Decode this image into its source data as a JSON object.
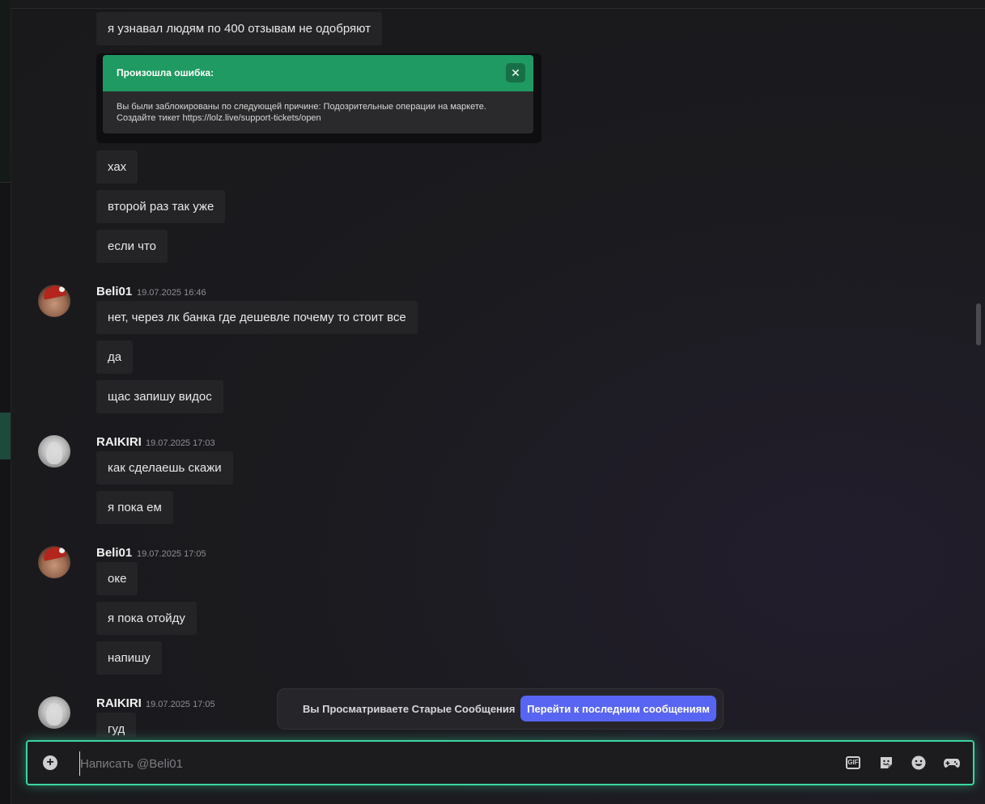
{
  "messages": {
    "b0": "я узнавал людям по 400 отзывам не одобряют",
    "b1": "хах",
    "b2": "второй раз так уже",
    "b3": "если что"
  },
  "error_embed": {
    "title": "Произошла ошибка:",
    "body_line1": "Вы были заблокированы по следующей причине: Подозрительные операции на маркете.",
    "body_line2": "Создайте тикет https://lolz.live/support-tickets/open"
  },
  "groups": [
    {
      "author": "Beli01",
      "time": "19.07.2025 16:46",
      "messages": [
        "нет, через лк банка где дешевле почему то стоит все",
        "да",
        "щас запишу видос"
      ]
    },
    {
      "author": "RAIKIRI",
      "time": "19.07.2025 17:03",
      "messages": [
        "как сделаешь скажи",
        "я пока ем"
      ]
    },
    {
      "author": "Beli01",
      "time": "19.07.2025 17:05",
      "messages": [
        "оке",
        "я пока отойду",
        "напишу"
      ]
    },
    {
      "author": "RAIKIRI",
      "time": "19.07.2025 17:05",
      "messages": [
        "гуд"
      ]
    }
  ],
  "jump_bar": {
    "text": "Вы Просматриваете Старые Сообщения",
    "button": "Перейти к последним сообщениям"
  },
  "composer": {
    "placeholder": "Написать @Beli01",
    "gif_label": "GIF"
  },
  "icons": {
    "plus": "plus-circle-icon",
    "gif": "gif-icon",
    "sticker": "sticker-icon",
    "emoji": "emoji-icon",
    "activity": "gamepad-icon"
  },
  "colors": {
    "accent_green": "#3bd6a0",
    "error_header": "#1f9a62",
    "button_blurple": "#5865f2"
  }
}
